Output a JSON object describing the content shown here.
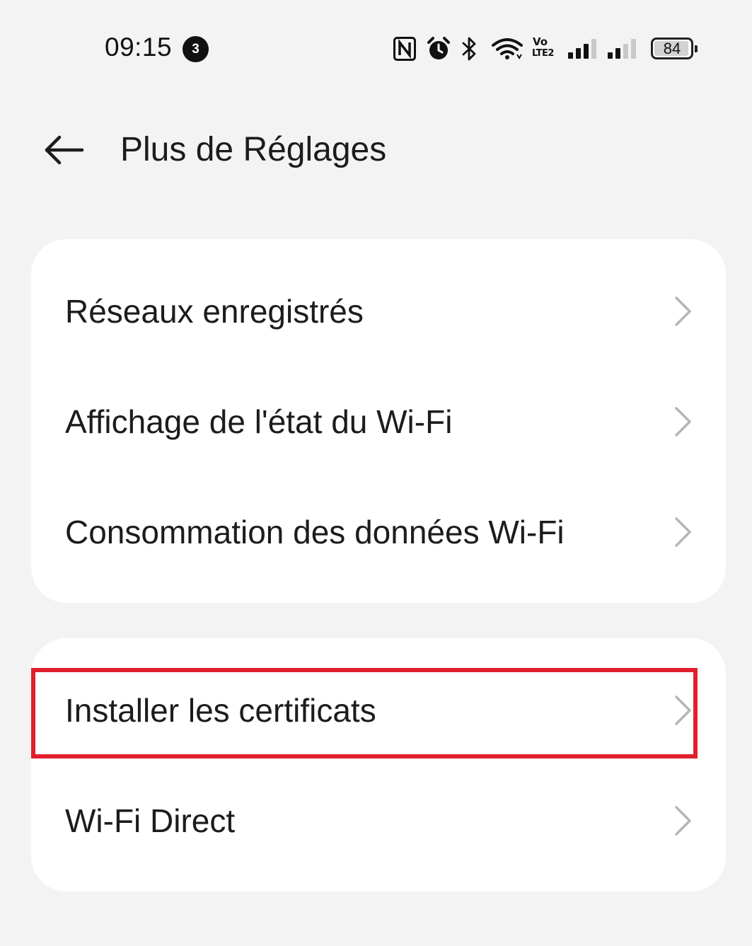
{
  "status_bar": {
    "time": "09:15",
    "notification_count": "3",
    "volte_label_top": "Vo",
    "volte_label_bottom": "LTE2",
    "battery_level": "84"
  },
  "header": {
    "title": "Plus de Réglages"
  },
  "groups": [
    {
      "items": [
        {
          "label": "Réseaux enregistrés"
        },
        {
          "label": "Affichage de l'état du Wi-Fi"
        },
        {
          "label": "Consommation des données Wi-Fi"
        }
      ]
    },
    {
      "items": [
        {
          "label": "Installer les certificats",
          "highlighted": true
        },
        {
          "label": "Wi-Fi Direct"
        }
      ]
    }
  ],
  "colors": {
    "background": "#f3f3f3",
    "card": "#ffffff",
    "highlight": "#e0202c",
    "chevron": "#b5b5b5"
  }
}
